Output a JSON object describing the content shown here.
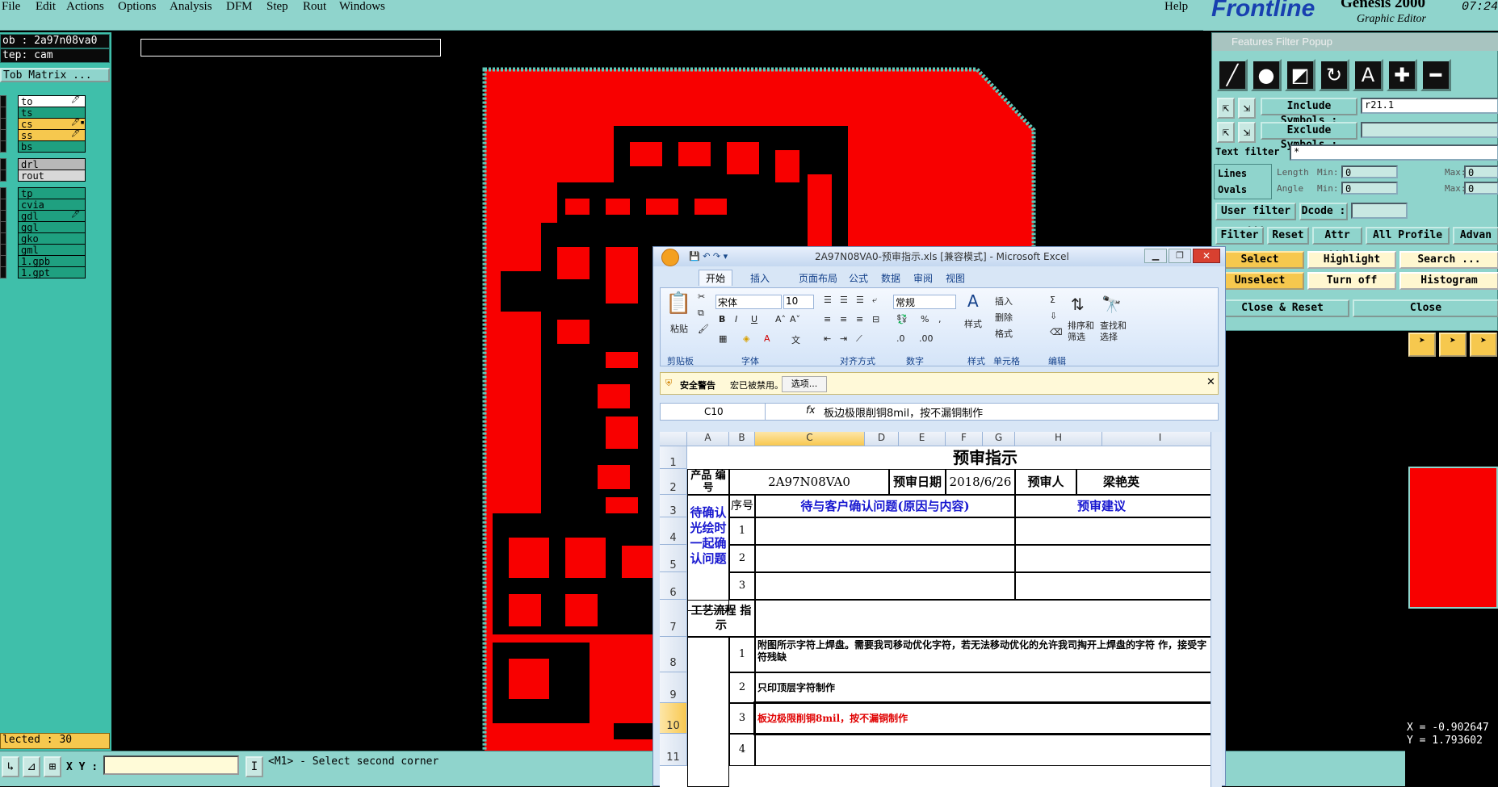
{
  "menu": {
    "file": "File",
    "edit": "Edit",
    "actions": "Actions",
    "options": "Options",
    "analysis": "Analysis",
    "dfm": "DFM",
    "step": "Step",
    "rout": "Rout",
    "windows": "Windows",
    "help": "Help"
  },
  "brand": {
    "logo": "Frontline",
    "title": "Genesis 2000",
    "subtitle": "Graphic Editor",
    "clock": "07:24"
  },
  "left": {
    "job": "ob : 2a97n08va0",
    "step": "tep: cam",
    "matrix": "Tob Matrix ...",
    "selected": "lected : 30"
  },
  "layers": [
    {
      "name": "to",
      "color": "#ffffff",
      "pen": "🖊"
    },
    {
      "name": "ts",
      "color": "#1fa080",
      "pen": ""
    },
    {
      "name": "cs",
      "color": "#f6c84e",
      "pen": "🖊▪"
    },
    {
      "name": "ss",
      "color": "#f6c84e",
      "pen": "🖊"
    },
    {
      "name": "bs",
      "color": "#1fa080",
      "pen": ""
    },
    {
      "name": "drl",
      "color": "#b8b8b8",
      "pen": ""
    },
    {
      "name": "rout",
      "color": "#d8d8d8",
      "pen": ""
    },
    {
      "name": "tp",
      "color": "#1fa080",
      "pen": ""
    },
    {
      "name": "cvia",
      "color": "#1fa080",
      "pen": ""
    },
    {
      "name": "gdl",
      "color": "#1fa080",
      "pen": "🖊"
    },
    {
      "name": "ggl",
      "color": "#1fa080",
      "pen": ""
    },
    {
      "name": "gko",
      "color": "#1fa080",
      "pen": ""
    },
    {
      "name": "gml",
      "color": "#1fa080",
      "pen": ""
    },
    {
      "name": "1.gpb",
      "color": "#1fa080",
      "pen": ""
    },
    {
      "name": "1.gpt",
      "color": "#1fa080",
      "pen": ""
    }
  ],
  "bottom": {
    "xy_label": "X Y :",
    "status": "<M1> - Select second corner",
    "far_right": "In"
  },
  "ffp": {
    "title": "Features Filter Popup",
    "include_label": "Include Symbols :",
    "include_value": "r21.1",
    "exclude_label": "Exclude Symbols :",
    "exclude_value": "",
    "text_filter": "Text filter",
    "text_value": "*",
    "lines": "Lines",
    "ovals": "Ovals",
    "length": "Length",
    "angle": "Angle",
    "min": "Min:",
    "max": "Max:",
    "zero": "0",
    "user_filter": "User filter ...",
    "dcode": "Dcode :",
    "filter": "Filter",
    "reset": "Reset",
    "attr": "Attr ...",
    "all_profile": "All Profile",
    "advanced": "Advan",
    "select": "Select",
    "highlight": "Highlight",
    "search": "Search ...",
    "unselect": "Unselect",
    "turn_off": "Turn off",
    "histogram": "Histogram",
    "close_reset": "Close & Reset",
    "close": "Close"
  },
  "coords": {
    "x": "X = -0.902647",
    "y": "Y = 1.793602"
  },
  "excel": {
    "title": "2A97N08VA0-预审指示.xls [兼容模式] - Microsoft Excel",
    "tabs": [
      "开始",
      "插入",
      "页面布局",
      "公式",
      "数据",
      "审阅",
      "视图"
    ],
    "groups": [
      "剪贴板",
      "字体",
      "对齐方式",
      "数字",
      "样式",
      "单元格",
      "编辑"
    ],
    "paste": "粘贴",
    "font": "宋体",
    "size": "10",
    "number_format": "常规",
    "styles": "样式",
    "insert": "插入",
    "delete": "删除",
    "format": "格式",
    "sort": "排序和 筛选",
    "find": "查找和 选择",
    "security_warning": "安全警告",
    "macros_disabled": "宏已被禁用。",
    "options": "选项...",
    "namebox": "C10",
    "formula": "板边极限削铜8mil，按不漏铜制作",
    "columns": [
      "A",
      "B",
      "C",
      "D",
      "E",
      "F",
      "G",
      "H",
      "I"
    ],
    "rows": [
      "1",
      "2",
      "3",
      "4",
      "5",
      "6",
      "7",
      "8",
      "9",
      "10",
      "11"
    ],
    "cells": {
      "title": "预审指示",
      "product_no": "产品 编号",
      "product_value": "2A97N08VA0",
      "date_label": "预审日期",
      "date_value": "2018/6/26",
      "reviewer": "预审人",
      "reviewer_name": "梁艳英",
      "pending": "待确认 光绘时 一起确 认问题",
      "seq": "序号",
      "issue": "待与客户确认问题(原因与内容)",
      "advice": "预审建议",
      "n1": "1",
      "n2": "2",
      "n3": "3",
      "n4": "4",
      "process": "工艺流程 指示",
      "p1": "附图所示字符上焊盘。需要我司移动优化字符，若无法移动优化的允许我司掏开上焊盘的字符 作，接受字符残缺",
      "p2": "只印顶层字符制作",
      "p3": "板边极限削铜8mil，按不漏铜制作"
    }
  },
  "colors": {
    "board": "#f80000",
    "teal": "#8fd4cc",
    "accent": "#1840b0"
  }
}
